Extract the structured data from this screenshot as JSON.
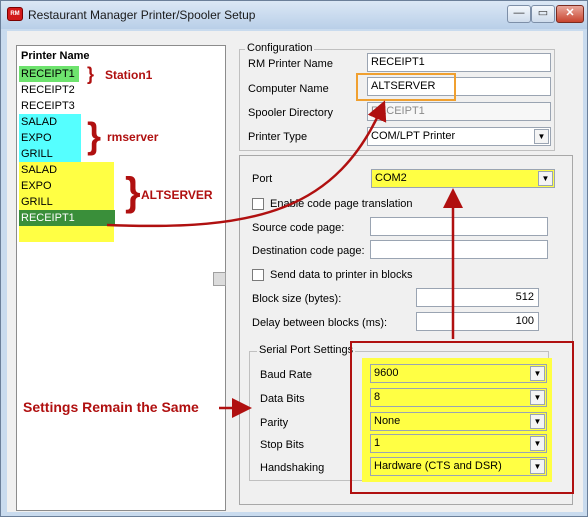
{
  "window": {
    "title": "Restaurant Manager Printer/Spooler Setup",
    "app_icon_text": "RM"
  },
  "title_buttons": {
    "minimize": "—",
    "maximize": "▭",
    "close": "✕"
  },
  "printer_list": {
    "header": "Printer Name",
    "items": [
      "RECEIPT1",
      "RECEIPT2",
      "RECEIPT3",
      "SALAD",
      "EXPO",
      "GRILL",
      "SALAD",
      "EXPO",
      "GRILL",
      "RECEIPT1"
    ],
    "selected_index": 9
  },
  "annotations": {
    "station1": "Station1",
    "rmserver": "rmserver",
    "altserver": "ALTSERVER",
    "settings_note": "Settings Remain the Same",
    "colors": {
      "annotation_red": "#b01010",
      "highlight_yellow": "#ffff44",
      "highlight_cyan": "#55ffff",
      "highlight_green": "#6ee36e",
      "selected_green": "#3a8f3a",
      "orange_box": "#f0a030"
    }
  },
  "configuration": {
    "group_label": "Configuration",
    "rm_printer_name_label": "RM Printer Name",
    "rm_printer_name": "RECEIPT1",
    "computer_name_label": "Computer Name",
    "computer_name": "ALTSERVER",
    "spooler_directory_label": "Spooler Directory",
    "spooler_directory": "RECEIPT1",
    "printer_type_label": "Printer Type",
    "printer_type": "COM/LPT Printer"
  },
  "port_settings": {
    "port_label": "Port",
    "port": "COM2",
    "enable_code_page_label": "Enable code page translation",
    "source_code_page_label": "Source code page:",
    "source_code_page": "",
    "destination_code_page_label": "Destination code page:",
    "destination_code_page": "",
    "send_in_blocks_label": "Send data to printer in blocks",
    "block_size_label": "Block size (bytes):",
    "block_size": "512",
    "delay_label": "Delay between blocks (ms):",
    "delay": "100"
  },
  "serial": {
    "group_label": "Serial Port Settings",
    "baud_rate_label": "Baud Rate",
    "baud_rate": "9600",
    "data_bits_label": "Data Bits",
    "data_bits": "8",
    "parity_label": "Parity",
    "parity": "None",
    "stop_bits_label": "Stop Bits",
    "stop_bits": "1",
    "handshaking_label": "Handshaking",
    "handshaking": "Hardware (CTS and DSR)"
  }
}
